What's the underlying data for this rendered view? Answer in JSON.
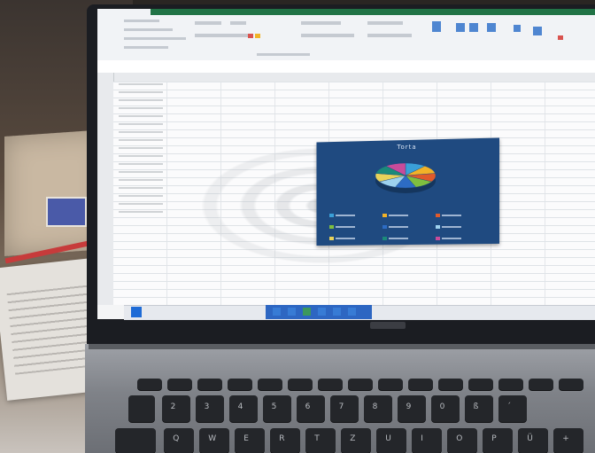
{
  "chart": {
    "title": "Torta",
    "slice_colors": [
      "#3aa0d8",
      "#f2b227",
      "#e05a2a",
      "#7fbf3f",
      "#2d6cc4",
      "#9ed2ee",
      "#e8d25a",
      "#1b8a7a",
      "#c84b9a"
    ]
  },
  "keyboard": {
    "row2": [
      "2",
      "3",
      "4",
      "5",
      "6",
      "7",
      "8",
      "9",
      "0",
      "ß",
      "´"
    ],
    "row3": [
      "Q",
      "W",
      "E",
      "R",
      "T",
      "Z",
      "U",
      "I",
      "O",
      "P",
      "Ü",
      "+"
    ]
  },
  "colors": {
    "excel_green": "#217346",
    "chart_background": "#1f4a80",
    "keycap": "#24262a",
    "deck": "#8a8d93"
  }
}
